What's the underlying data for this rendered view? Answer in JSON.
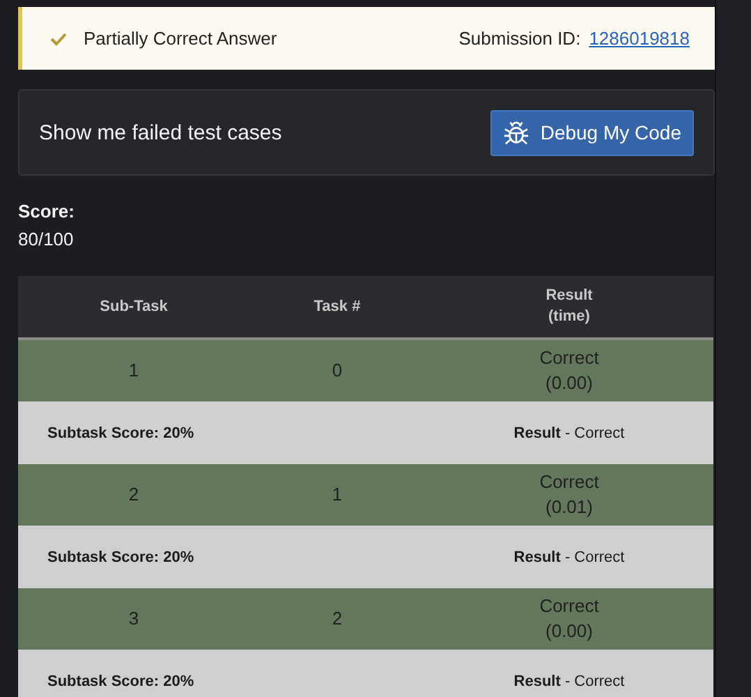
{
  "alert": {
    "status": "Partially Correct Answer",
    "submission_label": "Submission ID:",
    "submission_id": "1286019818"
  },
  "debug_panel": {
    "text": "Show me failed test cases",
    "button": "Debug My Code"
  },
  "score": {
    "label": "Score:",
    "value": "80/100"
  },
  "table": {
    "columns": [
      {
        "label": "Sub-Task"
      },
      {
        "label": "Task #"
      },
      {
        "label": "Result",
        "sublabel": "(time)"
      }
    ],
    "rows": [
      {
        "subtask": "1",
        "task": "0",
        "result": "Correct",
        "time": "(0.00)",
        "subtask_score": "Subtask Score: 20%",
        "subtask_result": "**Result** - Correct"
      },
      {
        "subtask": "2",
        "task": "1",
        "result": "Correct",
        "time": "(0.01)",
        "subtask_score": "Subtask Score: 20%",
        "subtask_result": "**Result** - Correct"
      },
      {
        "subtask": "3",
        "task": "2",
        "result": "Correct",
        "time": "(0.00)",
        "subtask_score": "Subtask Score: 20%",
        "subtask_result": "**Result** - Correct"
      }
    ]
  }
}
